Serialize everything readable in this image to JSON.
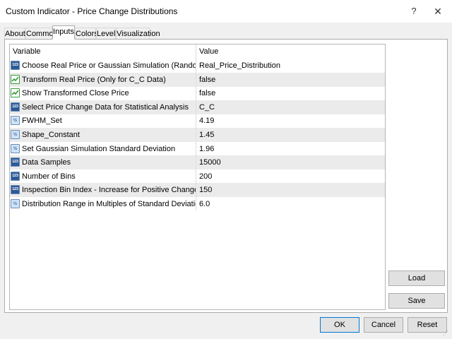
{
  "window": {
    "title": "Custom Indicator - Price Change Distributions",
    "help_glyph": "?",
    "close_glyph": "✕"
  },
  "tabs": [
    {
      "label": "About",
      "active": false
    },
    {
      "label": "Common",
      "active": false
    },
    {
      "label": "Inputs",
      "active": true
    },
    {
      "label": "Colors",
      "active": false
    },
    {
      "label": "Levels",
      "active": false
    },
    {
      "label": "Visualization",
      "active": false
    }
  ],
  "inputs": {
    "header": {
      "variable": "Variable",
      "value": "Value"
    },
    "rows": [
      {
        "icon": "int-icon",
        "icon_text": "123",
        "variable": "Choose Real Price or Gaussian Simulation (Random Walk)",
        "value": "Real_Price_Distribution"
      },
      {
        "icon": "bool-icon",
        "icon_text": "",
        "variable": "Transform Real Price (Only for C_C Data)",
        "value": "false"
      },
      {
        "icon": "bool-icon",
        "icon_text": "",
        "variable": "Show Transformed Close Price",
        "value": "false"
      },
      {
        "icon": "int-icon",
        "icon_text": "123",
        "variable": "Select Price Change Data for Statistical Analysis",
        "value": "C_C"
      },
      {
        "icon": "double-icon",
        "icon_text": "½",
        "variable": "FWHM_Set",
        "value": "4.19"
      },
      {
        "icon": "double-icon",
        "icon_text": "½",
        "variable": "Shape_Constant",
        "value": "1.45"
      },
      {
        "icon": "double-icon",
        "icon_text": "½",
        "variable": "Set Gaussian Simulation Standard Deviation",
        "value": "1.96"
      },
      {
        "icon": "int-icon",
        "icon_text": "123",
        "variable": "Data Samples",
        "value": "15000"
      },
      {
        "icon": "int-icon",
        "icon_text": "123",
        "variable": "Number of Bins",
        "value": "200"
      },
      {
        "icon": "int-icon",
        "icon_text": "123",
        "variable": "Inspection Bin Index - Increase for Positive Change",
        "value": "150"
      },
      {
        "icon": "double-icon",
        "icon_text": "½",
        "variable": "Distribution Range in Multiples of Standard Deviation",
        "value": "6.0"
      }
    ]
  },
  "side_buttons": {
    "load": "Load",
    "save": "Save"
  },
  "footer_buttons": {
    "ok": "OK",
    "cancel": "Cancel",
    "reset": "Reset"
  },
  "colors": {
    "accent": "#0078d7",
    "int_icon": "#2d5a96",
    "bool_icon": "#3a9a3a"
  }
}
